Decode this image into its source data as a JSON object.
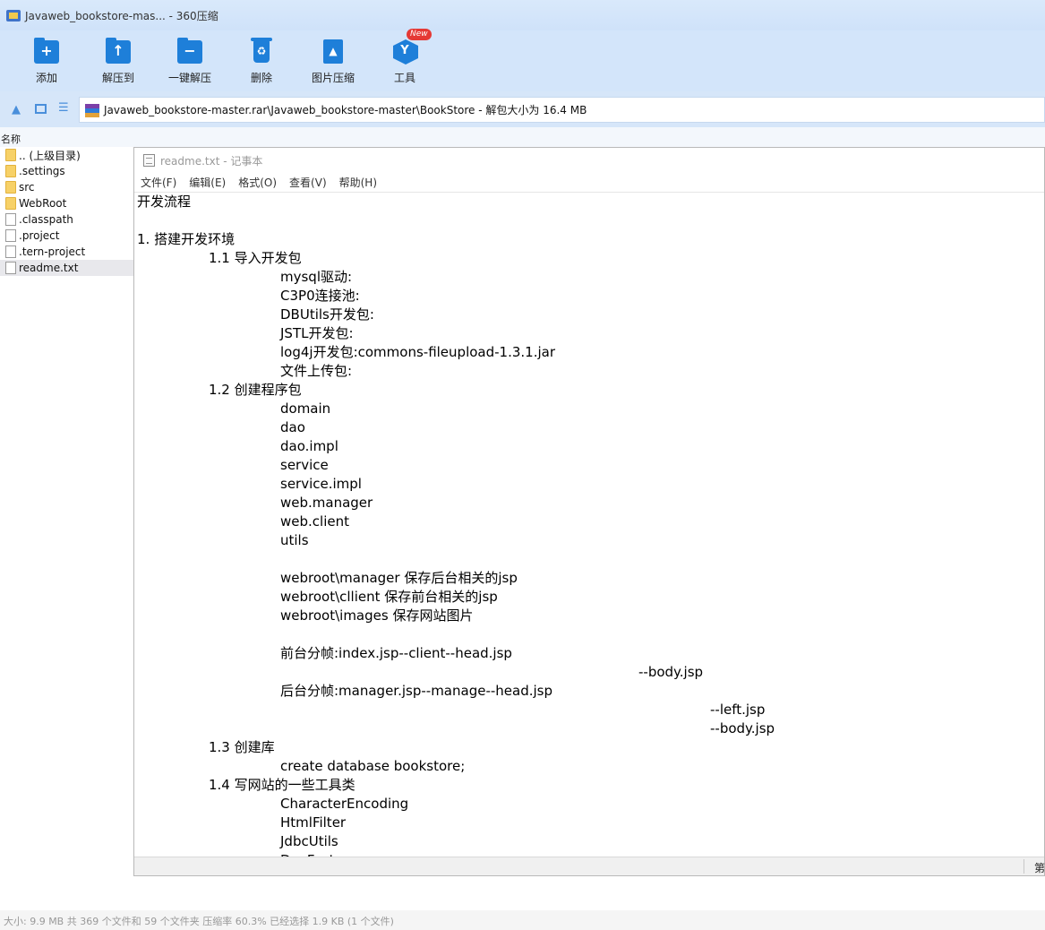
{
  "window": {
    "title": "Javaweb_bookstore-mas... - 360压缩"
  },
  "toolbar": {
    "buttons": [
      {
        "label": "添加",
        "icon": "add-icon"
      },
      {
        "label": "解压到",
        "icon": "extract-to-icon"
      },
      {
        "label": "一键解压",
        "icon": "quick-extract-icon"
      },
      {
        "label": "删除",
        "icon": "delete-icon"
      },
      {
        "label": "图片压缩",
        "icon": "image-compress-icon"
      },
      {
        "label": "工具",
        "icon": "tools-icon"
      }
    ],
    "badge": "New"
  },
  "address": {
    "path": "Javaweb_bookstore-master.rar\\Javaweb_bookstore-master\\BookStore - 解包大小为 16.4 MB"
  },
  "list": {
    "column_name": "名称",
    "items": [
      {
        "name": ".. (上级目录)",
        "type": "folder"
      },
      {
        "name": ".settings",
        "type": "folder"
      },
      {
        "name": "src",
        "type": "folder"
      },
      {
        "name": "WebRoot",
        "type": "folder"
      },
      {
        "name": ".classpath",
        "type": "file"
      },
      {
        "name": ".project",
        "type": "file"
      },
      {
        "name": ".tern-project",
        "type": "file"
      },
      {
        "name": "readme.txt",
        "type": "file",
        "selected": true
      }
    ]
  },
  "status": "大小: 9.9 MB 共 369 个文件和 59 个文件夹 压缩率 60.3% 已经选择 1.9 KB (1 个文件)",
  "notepad": {
    "title": "readme.txt - 记事本",
    "menu": [
      "文件(F)",
      "编辑(E)",
      "格式(O)",
      "查看(V)",
      "帮助(H)"
    ],
    "lines": [
      "开发流程",
      "",
      "1. 搭建开发环境",
      "\t1.1 导入开发包",
      "\t\tmysql驱动:",
      "\t\tC3P0连接池:",
      "\t\tDBUtils开发包:",
      "\t\tJSTL开发包:",
      "\t\tlog4j开发包:commons-fileupload-1.3.1.jar",
      "\t\t文件上传包:",
      "\t1.2 创建程序包",
      "\t\tdomain",
      "\t\tdao",
      "\t\tdao.impl",
      "\t\tservice",
      "\t\tservice.impl",
      "\t\tweb.manager",
      "\t\tweb.client",
      "\t\tutils",
      "",
      "\t\twebroot\\manager 保存后台相关的jsp",
      "\t\twebroot\\cllient 保存前台相关的jsp",
      "\t\twebroot\\images 保存网站图片",
      "",
      "\t\t前台分帧:index.jsp--client--head.jsp",
      "\t\t\t\t\t\t\t--body.jsp",
      "\t\t后台分帧:manager.jsp--manage--head.jsp",
      "\t\t\t\t\t\t\t\t--left.jsp",
      "\t\t\t\t\t\t\t\t--body.jsp",
      "\t1.3 创建库",
      "\t\tcreate database bookstore;",
      "\t1.4 写网站的一些工具类",
      "\t\tCharacterEncoding",
      "\t\tHtmlFilter",
      "\t\tJdbcUtils",
      "\t\tDaoFactory"
    ],
    "status_partial": "第"
  }
}
